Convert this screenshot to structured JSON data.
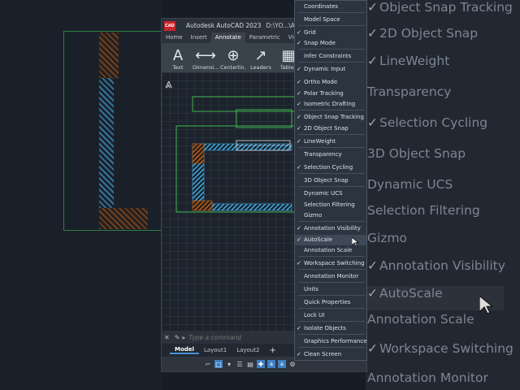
{
  "background_menu": {
    "items": [
      {
        "label": "Object Snap Tracking",
        "checked": true
      },
      {
        "label": "2D Object Snap",
        "checked": true
      },
      {
        "label": "LineWeight",
        "checked": true
      },
      {
        "label": "Transparency",
        "checked": false
      },
      {
        "label": "Selection Cycling",
        "checked": true
      },
      {
        "label": "3D Object Snap",
        "checked": false
      },
      {
        "label": "Dynamic UCS",
        "checked": false
      },
      {
        "label": "Selection Filtering",
        "checked": false
      },
      {
        "label": "Gizmo",
        "checked": false
      },
      {
        "label": "Annotation Visibility",
        "checked": true
      },
      {
        "label": "AutoScale",
        "checked": true
      },
      {
        "label": "Annotation Scale",
        "checked": false
      },
      {
        "label": "Workspace Switching",
        "checked": true
      },
      {
        "label": "Annotation Monitor",
        "checked": false
      }
    ]
  },
  "app": {
    "logo_text": "CAD",
    "title": "Autodesk AutoCAD 2023",
    "path": "D:\\YO...\\Annotatio",
    "tabs": [
      {
        "label": "Home",
        "active": false
      },
      {
        "label": "Insert",
        "active": false
      },
      {
        "label": "Annotate",
        "active": true
      },
      {
        "label": "Parametric",
        "active": false
      },
      {
        "label": "View",
        "active": false
      }
    ],
    "ribbon": [
      {
        "label": "Text",
        "icon": "text-icon"
      },
      {
        "label": "Dimensi...",
        "icon": "dimension-icon"
      },
      {
        "label": "Centerlin...",
        "icon": "centerline-icon"
      },
      {
        "label": "Leaders",
        "icon": "leader-icon"
      },
      {
        "label": "Tables",
        "icon": "table-icon"
      }
    ],
    "command_placeholder": "Type a command",
    "layout_tabs": [
      {
        "label": "Model",
        "active": true
      },
      {
        "label": "Layout1",
        "active": false
      },
      {
        "label": "Layout2",
        "active": false
      },
      {
        "label": "+",
        "active": false
      }
    ]
  },
  "context_menu": {
    "items": [
      {
        "label": "Coordinates",
        "checked": false
      },
      {
        "label": "Model Space",
        "checked": false
      },
      {
        "label": "Grid",
        "checked": true
      },
      {
        "label": "Snap Mode",
        "checked": true
      },
      {
        "label": "Infer Constraints",
        "checked": false
      },
      {
        "label": "Dynamic Input",
        "checked": true
      },
      {
        "label": "Ortho Mode",
        "checked": true
      },
      {
        "label": "Polar Tracking",
        "checked": true
      },
      {
        "label": "Isometric Drafting",
        "checked": true
      },
      {
        "label": "Object Snap Tracking",
        "checked": true
      },
      {
        "label": "2D Object Snap",
        "checked": true
      },
      {
        "label": "LineWeight",
        "checked": true
      },
      {
        "label": "Transparency",
        "checked": false
      },
      {
        "label": "Selection Cycling",
        "checked": true
      },
      {
        "label": "3D Object Snap",
        "checked": false
      },
      {
        "label": "Dynamic UCS",
        "checked": false
      },
      {
        "label": "Selection Filtering",
        "checked": false
      },
      {
        "label": "Gizmo",
        "checked": false
      },
      {
        "label": "Annotation Visibility",
        "checked": true
      },
      {
        "label": "AutoScale",
        "checked": true,
        "highlighted": true
      },
      {
        "label": "Annotation Scale",
        "checked": false
      },
      {
        "label": "Workspace Switching",
        "checked": true
      },
      {
        "label": "Annotation Monitor",
        "checked": false
      },
      {
        "label": "Units",
        "checked": false
      },
      {
        "label": "Quick Properties",
        "checked": false
      },
      {
        "label": "Lock UI",
        "checked": false
      },
      {
        "label": "Isolate Objects",
        "checked": true
      },
      {
        "label": "Graphics Performance",
        "checked": false
      },
      {
        "label": "Clean Screen",
        "checked": true
      }
    ]
  },
  "colors": {
    "accent": "#3d7fc4",
    "logo_red": "#c8242c",
    "hatch_orange": "#8a4a1e",
    "hatch_blue": "#3f8fbf",
    "line_green": "#3aa84a"
  }
}
